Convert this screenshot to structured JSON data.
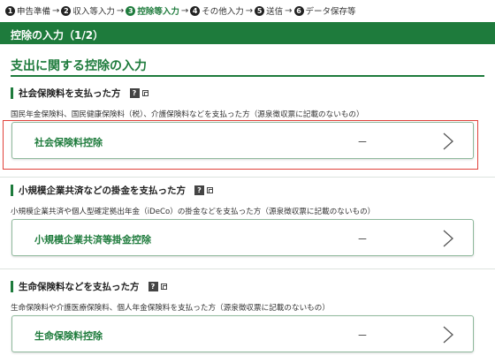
{
  "steps": [
    {
      "num": "1",
      "label": "申告準備",
      "active": false
    },
    {
      "num": "2",
      "label": "収入等入力",
      "active": false
    },
    {
      "num": "3",
      "label": "控除等入力",
      "active": true
    },
    {
      "num": "4",
      "label": "その他入力",
      "active": false
    },
    {
      "num": "5",
      "label": "送信",
      "active": false
    },
    {
      "num": "6",
      "label": "データ保存等",
      "active": false
    }
  ],
  "arrow": "→",
  "header": {
    "title": "控除の入力（1/2）"
  },
  "section": {
    "title": "支出に関する控除の入力"
  },
  "help_label": "?",
  "groups": [
    {
      "title": "社会保険料を支払った方",
      "description": "国民年金保険料、国民健康保険料（税）、介護保険料などを支払った方（源泉徴収票に記載のないもの）",
      "card_label": "社会保険料控除",
      "card_value": "－"
    },
    {
      "title": "小規模企業共済などの掛金を支払った方",
      "description": "小規模企業共済や個人型確定拠出年金（iDeCo）の掛金などを支払った方（源泉徴収票に記載のないもの）",
      "card_label": "小規模企業共済等掛金控除",
      "card_value": "－"
    },
    {
      "title": "生命保険料などを支払った方",
      "description": "生命保険料や介護医療保険料、個人年金保険料を支払った方（源泉徴収票に記載のないもの）",
      "card_label": "生命保険料控除",
      "card_value": "－"
    }
  ],
  "colors": {
    "accent": "#1e7b3c",
    "highlight": "#e0413a"
  }
}
